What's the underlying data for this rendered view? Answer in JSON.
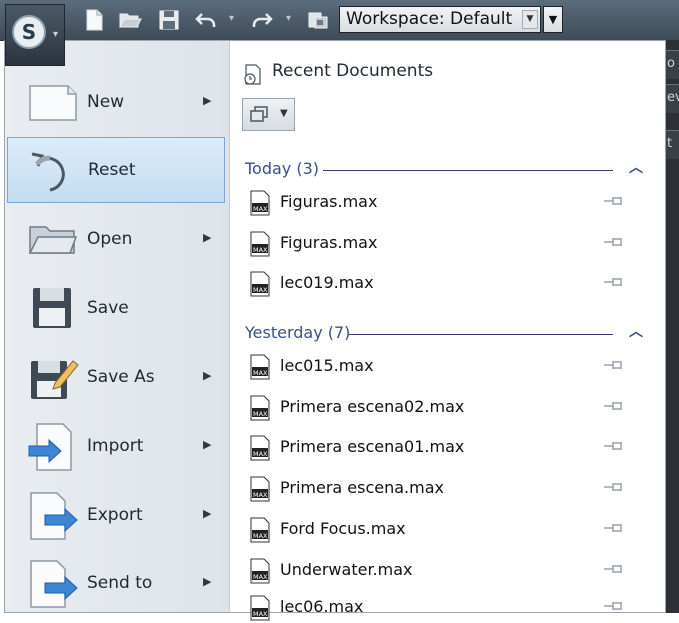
{
  "toolbar": {
    "workspace_label": "Workspace: Default",
    "icons": [
      "new-file-icon",
      "open-folder-icon",
      "save-icon",
      "undo-icon",
      "redo-icon",
      "project-folder-icon"
    ]
  },
  "app_button": {
    "logo_letter": "S"
  },
  "menu": {
    "items": [
      {
        "label": "New",
        "icon": "new-document-icon",
        "has_submenu": true
      },
      {
        "label": "Reset",
        "icon": "reset-icon",
        "has_submenu": false,
        "selected": true
      },
      {
        "label": "Open",
        "icon": "open-folder-icon",
        "has_submenu": true
      },
      {
        "label": "Save",
        "icon": "save-icon",
        "has_submenu": false
      },
      {
        "label": "Save As",
        "icon": "save-as-icon",
        "has_submenu": true
      },
      {
        "label": "Import",
        "icon": "import-icon",
        "has_submenu": true
      },
      {
        "label": "Export",
        "icon": "export-icon",
        "has_submenu": true
      },
      {
        "label": "Send to",
        "icon": "send-to-icon",
        "has_submenu": true
      }
    ]
  },
  "recent": {
    "title": "Recent Documents",
    "groups": [
      {
        "label": "Today (3)",
        "files": [
          "Figuras.max",
          "Figuras.max",
          "lec019.max"
        ]
      },
      {
        "label": "Yesterday (7)",
        "files": [
          "lec015.max",
          "Primera escena02.max",
          "Primera escena01.max",
          "Primera escena.max",
          "Ford Focus.max",
          "Underwater.max",
          "lec06.max"
        ]
      }
    ]
  },
  "right_edge": {
    "chars": [
      "o",
      "ev",
      "t"
    ]
  },
  "colors": {
    "accent": "#3b4f8a",
    "selection": "#c4dcf1",
    "toolbar": "#4a5866"
  }
}
